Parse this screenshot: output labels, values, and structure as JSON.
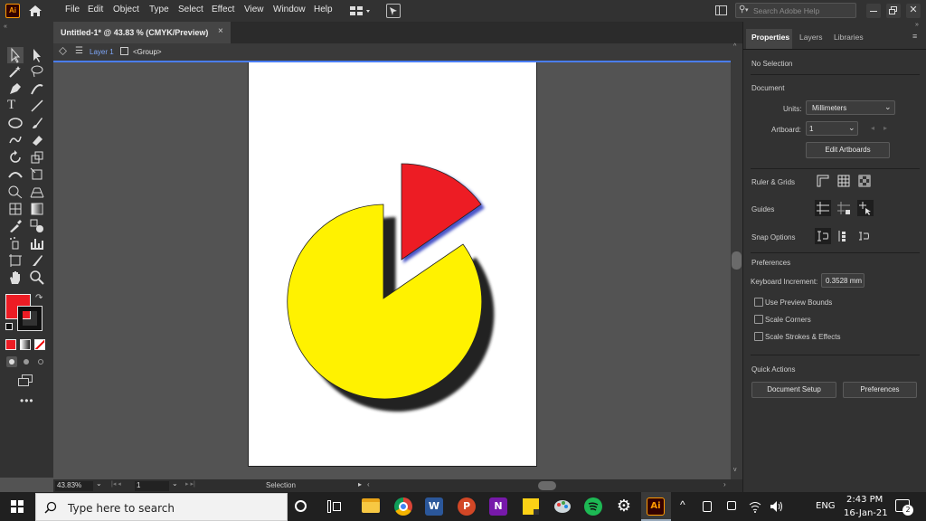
{
  "app": {
    "logo_text": "Ai"
  },
  "menu": [
    "File",
    "Edit",
    "Object",
    "Type",
    "Select",
    "Effect",
    "View",
    "Window",
    "Help"
  ],
  "search": {
    "placeholder": "Search Adobe Help"
  },
  "document_tab": {
    "title": "Untitled-1* @ 43.83 % (CMYK/Preview)",
    "close_glyph": "×"
  },
  "breadcrumb": {
    "layer": "Layer 1",
    "group": "<Group>"
  },
  "status": {
    "zoom": "43.83%",
    "artboard": "1",
    "tool": "Selection"
  },
  "fill_color": "#ed1c24",
  "artwork": {
    "yellow_fill": "#fff200",
    "red_fill": "#ed1c24",
    "guide_color": "#4a7df5"
  },
  "panel": {
    "tabs": [
      "Properties",
      "Layers",
      "Libraries"
    ],
    "selection_state": "No Selection",
    "document_heading": "Document",
    "units_label": "Units:",
    "units_value": "Millimeters",
    "artboard_label": "Artboard:",
    "artboard_value": "1",
    "edit_artboards": "Edit Artboards",
    "ruler_grids": "Ruler & Grids",
    "guides": "Guides",
    "snap_options": "Snap Options",
    "preferences_heading": "Preferences",
    "keyboard_increment_label": "Keyboard Increment:",
    "keyboard_increment_value": "0.3528 mm",
    "checkboxes": [
      "Use Preview Bounds",
      "Scale Corners",
      "Scale Strokes & Effects"
    ],
    "quick_actions": "Quick Actions",
    "document_setup": "Document Setup",
    "preferences_button": "Preferences"
  },
  "taskbar": {
    "search_placeholder": "Type here to search",
    "language": "ENG",
    "time": "2:43 PM",
    "date": "16-Jan-21",
    "notifications": "2",
    "app_word": "W",
    "app_powerpoint": "P",
    "app_onenote": "N",
    "app_illustrator": "Ai"
  }
}
